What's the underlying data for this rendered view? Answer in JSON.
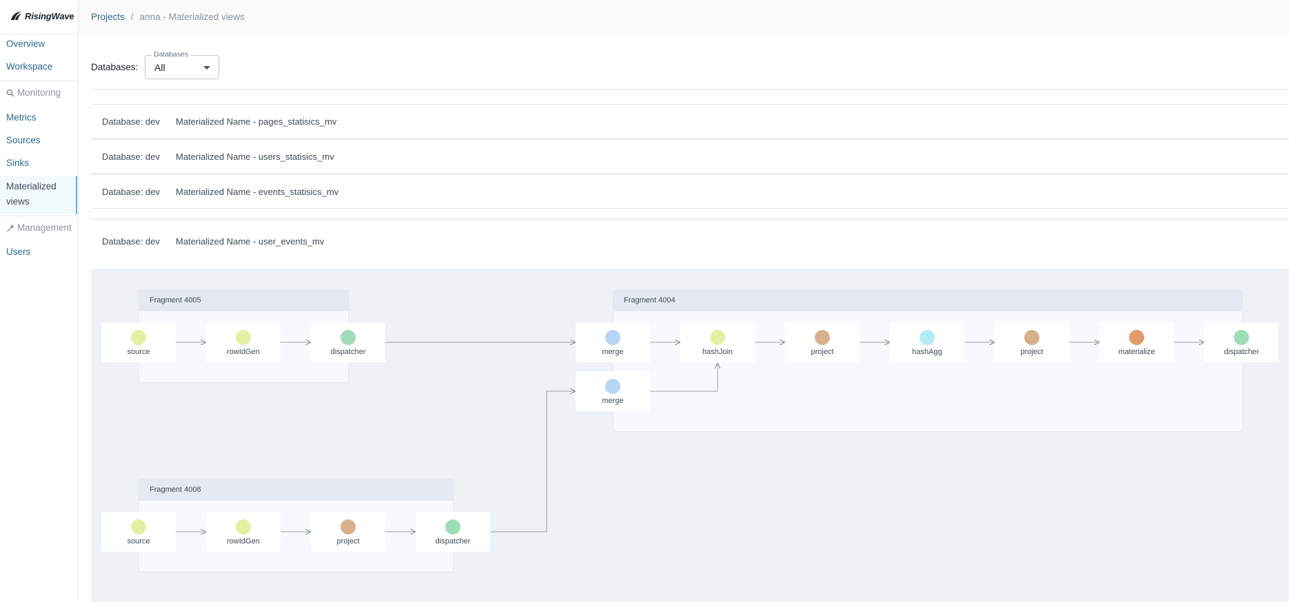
{
  "app": {
    "logo_text": "RisingWave"
  },
  "sidebar": {
    "items": [
      {
        "label": "Overview"
      },
      {
        "label": "Workspace"
      }
    ],
    "sections": [
      {
        "label": "Monitoring",
        "icon": "magnifier-icon"
      },
      {
        "label": "Management",
        "icon": "wrench-icon"
      }
    ],
    "monitoring_items": [
      {
        "label": "Metrics"
      },
      {
        "label": "Sources"
      },
      {
        "label": "Sinks"
      },
      {
        "label": "Materialized views",
        "active": true
      }
    ],
    "management_items": [
      {
        "label": "Users"
      }
    ]
  },
  "breadcrumb": {
    "root": "Projects",
    "separator": "/",
    "current": "anna - Materialized views"
  },
  "filter": {
    "label": "Databases:",
    "legend": "Databases",
    "value": "All"
  },
  "materialized_views": [
    {
      "database": "Database: dev",
      "name": "Materialized Name - pages_statisics_mv"
    },
    {
      "database": "Database: dev",
      "name": "Materialized Name - users_statisics_mv"
    },
    {
      "database": "Database: dev",
      "name": "Materialized Name - events_statisics_mv"
    },
    {
      "database": "Database: dev",
      "name": "Materialized Name - user_events_mv",
      "expanded": true
    }
  ],
  "graph": {
    "fragments": [
      {
        "title": "Fragment 4005"
      },
      {
        "title": "Fragment 4004"
      },
      {
        "title": "Fragment 4006"
      }
    ],
    "nodes": [
      {
        "label": "source",
        "color": "#e3f0a3"
      },
      {
        "label": "rowIdGen",
        "color": "#e3f0a3"
      },
      {
        "label": "dispatcher",
        "color": "#9fdcb8"
      },
      {
        "label": "merge",
        "color": "#b5d6f4"
      },
      {
        "label": "hashJoin",
        "color": "#e3f0a3"
      },
      {
        "label": "project",
        "color": "#d9b08c"
      },
      {
        "label": "hashAgg",
        "color": "#b3ecf7"
      },
      {
        "label": "project",
        "color": "#d9b08c"
      },
      {
        "label": "materialize",
        "color": "#e39a6b"
      },
      {
        "label": "dispatcher",
        "color": "#9fdcb8"
      },
      {
        "label": "merge",
        "color": "#b5d6f4"
      },
      {
        "label": "source",
        "color": "#e3f0a3"
      },
      {
        "label": "rowIdGen",
        "color": "#e3f0a3"
      },
      {
        "label": "project",
        "color": "#d9b08c"
      },
      {
        "label": "dispatcher",
        "color": "#9fdcb8"
      }
    ]
  }
}
